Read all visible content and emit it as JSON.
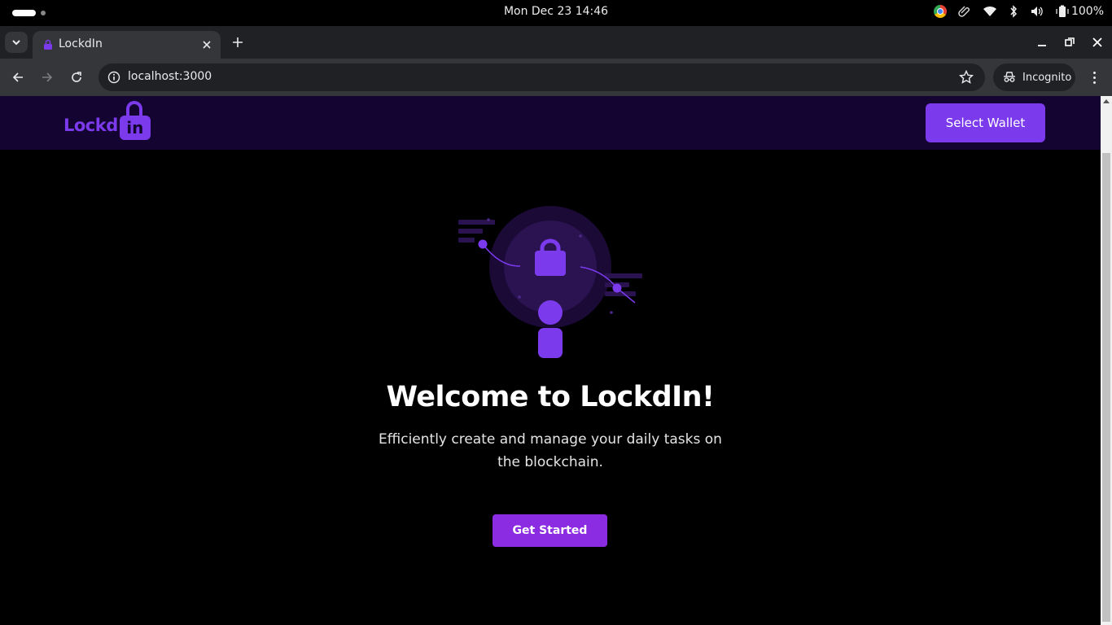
{
  "os": {
    "clock": "Mon Dec 23  14:46",
    "battery": "100%"
  },
  "browser": {
    "tab_title": "LockdIn",
    "url": "localhost:3000",
    "incognito_label": "Incognito"
  },
  "app": {
    "logo_text": "Lockd",
    "logo_in": "in",
    "select_wallet_label": "Select Wallet",
    "hero_title": "Welcome to LockdIn!",
    "hero_subtitle": "Efficiently create and manage your daily tasks on the blockchain.",
    "get_started_label": "Get Started"
  },
  "colors": {
    "accent": "#7c3aed",
    "header_bg": "#140432",
    "page_bg": "#000000",
    "button_purple": "#8b2be2"
  }
}
